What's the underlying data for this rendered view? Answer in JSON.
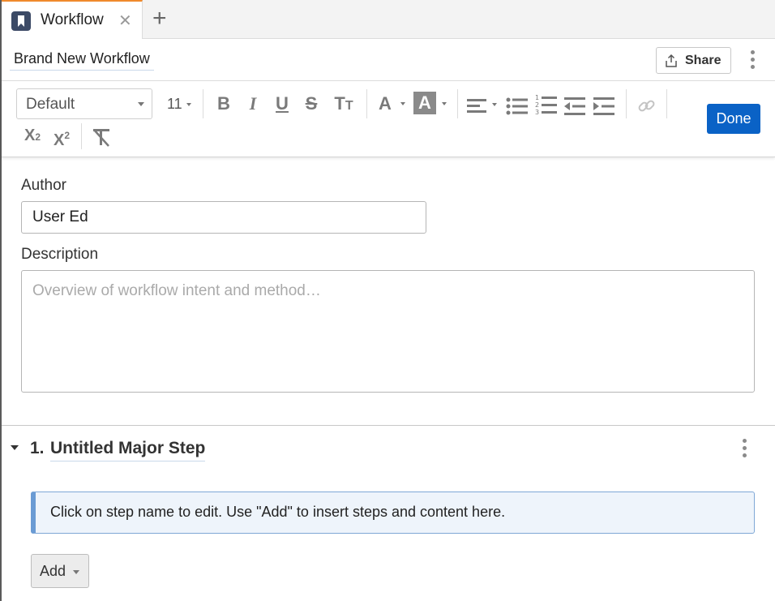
{
  "tabs": [
    {
      "label": "Workflow",
      "icon": "workflow-icon",
      "active": true
    }
  ],
  "colors": {
    "accent": "#f08a2c",
    "primary": "#0a62c6",
    "info_border": "#6a9bd4",
    "info_bg": "#eef4fb"
  },
  "header": {
    "title": "Brand New Workflow",
    "share_label": "Share"
  },
  "toolbar": {
    "font_family": "Default",
    "font_size": "11",
    "done_label": "Done",
    "icons": [
      "bold-icon",
      "italic-icon",
      "underline-icon",
      "strikethrough-icon",
      "text-size-icon",
      "text-color-icon",
      "highlight-color-icon",
      "align-icon",
      "bullet-list-icon",
      "numbered-list-icon",
      "outdent-icon",
      "indent-icon",
      "link-icon",
      "subscript-icon",
      "superscript-icon",
      "clear-format-icon"
    ]
  },
  "form": {
    "author_label": "Author",
    "author_value": "User Ed",
    "description_label": "Description",
    "description_placeholder": "Overview of workflow intent and method…"
  },
  "step": {
    "number": "1.",
    "name": "Untitled Major Step",
    "hint": "Click on step name to edit. Use \"Add\" to insert steps and content here.",
    "add_label": "Add"
  }
}
